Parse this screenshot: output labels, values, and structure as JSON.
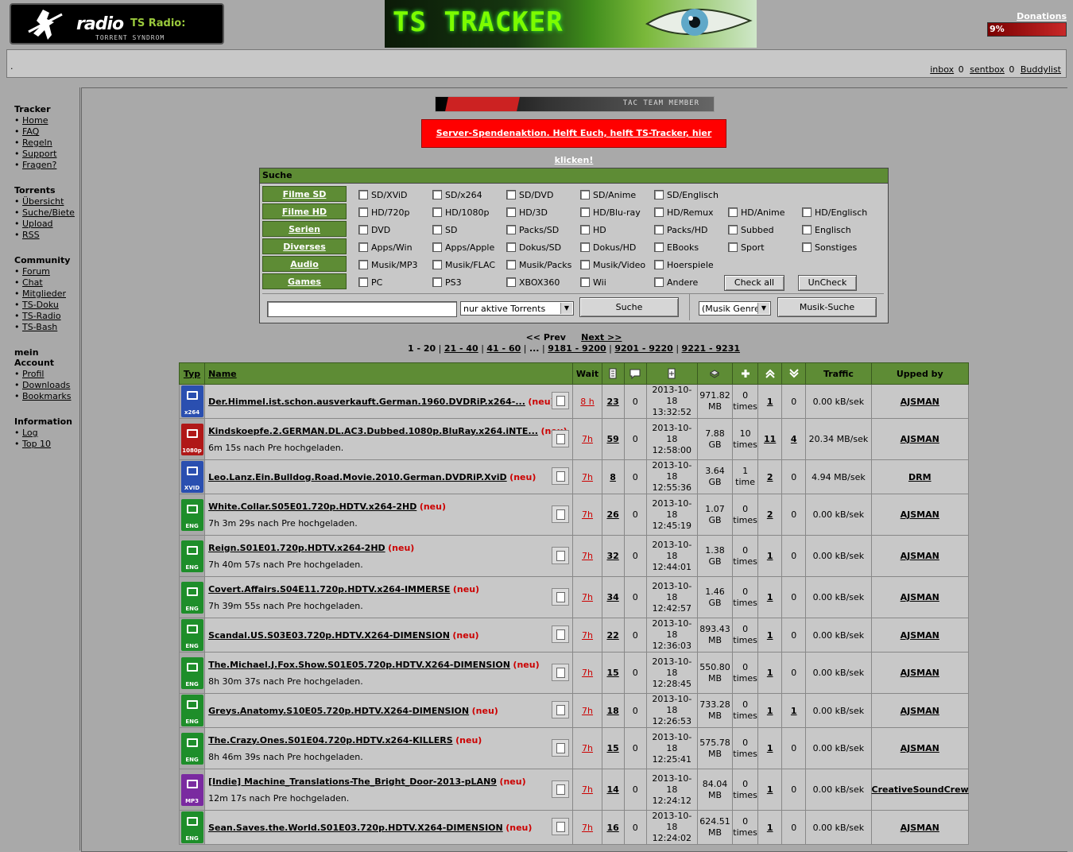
{
  "logo": {
    "text": "radio",
    "sub": "TS Radio:",
    "tagline": "TORRENT SYNDROM"
  },
  "banner": {
    "title": "TS TRACKER"
  },
  "donations": {
    "label": "Donations",
    "percent": "9%",
    "fraction": 0.09
  },
  "userlinks": {
    "inbox_label": "inbox",
    "inbox_count": "0",
    "sentbox_label": "sentbox",
    "sentbox_count": "0",
    "buddylist_label": "Buddylist"
  },
  "sidebar": [
    {
      "title": "Tracker",
      "items": [
        "Home",
        "FAQ",
        "Regeln",
        "Support",
        "Fragen?"
      ]
    },
    {
      "title": "Torrents",
      "items": [
        "Übersicht",
        "Suche/Biete",
        "Upload",
        "RSS"
      ]
    },
    {
      "title": "Community",
      "items": [
        "Forum",
        "Chat",
        "Mitglieder",
        "TS-Doku",
        "TS-Radio",
        "TS-Bash"
      ]
    },
    {
      "title": "mein Account",
      "items": [
        "Profil",
        "Downloads",
        "Bookmarks"
      ]
    },
    {
      "title": "Information",
      "items": [
        "Log",
        "Top 10"
      ]
    }
  ],
  "tac": {
    "text": "TAC TEAM MEMBER"
  },
  "spende": {
    "text": "Server-Spendenaktion. Helft Euch, helft TS-Tracker, hier klicken!"
  },
  "search": {
    "header": "Suche",
    "categories": [
      "Filme SD",
      "Filme HD",
      "Serien",
      "Diverses",
      "Audio",
      "Games"
    ],
    "checkbox_rows": [
      [
        "SD/XViD",
        "SD/x264",
        "SD/DVD",
        "SD/Anime",
        "SD/Englisch"
      ],
      [
        "HD/720p",
        "HD/1080p",
        "HD/3D",
        "HD/Blu-ray",
        "HD/Remux",
        "HD/Anime",
        "HD/Englisch"
      ],
      [
        "DVD",
        "SD",
        "Packs/SD",
        "HD",
        "Packs/HD",
        "Subbed",
        "Englisch"
      ],
      [
        "Apps/Win",
        "Apps/Apple",
        "Dokus/SD",
        "Dokus/HD",
        "EBooks",
        "Sport",
        "Sonstiges"
      ],
      [
        "Musik/MP3",
        "Musik/FLAC",
        "Musik/Packs",
        "Musik/Video",
        "Hoerspiele"
      ],
      [
        "PC",
        "PS3",
        "XBOX360",
        "Wii",
        "Andere"
      ]
    ],
    "check_all": "Check all",
    "uncheck": "UnCheck",
    "query": "",
    "filter_selected": "nur aktive Torrents",
    "submit": "Suche",
    "genre_selected": "(Musik Genre)",
    "music_submit": "Musik-Suche"
  },
  "pager": {
    "prev": "<< Prev",
    "next": "Next >>",
    "pages": [
      "1 - 20",
      "21 - 40",
      "41 - 60",
      "...",
      "9181 - 9200",
      "9201 - 9220",
      "9221 - 9231"
    ]
  },
  "table": {
    "headers": {
      "typ": "Typ",
      "name": "Name",
      "wait": "Wait",
      "traffic": "Traffic",
      "upped": "Upped by"
    },
    "rows": [
      {
        "icon": "x264",
        "color": "#2a4fb0",
        "name": "Der.Himmel.ist.schon.ausverkauft.German.1960.DVDRiP.x264-...",
        "neu": "(neu)",
        "pre": "",
        "wait": "8 h",
        "files": "23",
        "comments": "0",
        "date": "2013-10-18",
        "time": "13:32:52",
        "size": "971.82",
        "unit": "MB",
        "snatched": "0",
        "times": "times",
        "seeders": "1",
        "leechers": "0",
        "traffic": "0.00 kB/sek",
        "upper": "AJSMAN"
      },
      {
        "icon": "1080p",
        "color": "#b01818",
        "name": "Kindskoepfe.2.GERMAN.DL.AC3.Dubbed.1080p.BluRay.x264.iNTE...",
        "neu": "(neu)",
        "pre": "6m 15s nach Pre hochgeladen.",
        "wait": "7h",
        "files": "59",
        "comments": "0",
        "date": "2013-10-18",
        "time": "12:58:00",
        "size": "7.88",
        "unit": "GB",
        "snatched": "10",
        "times": "times",
        "seeders": "11",
        "leechers": "4",
        "traffic": "20.34 MB/sek",
        "upper": "AJSMAN"
      },
      {
        "icon": "XVID",
        "color": "#2a4fb0",
        "name": "Leo.Lanz.Ein.Bulldog.Road.Movie.2010.German.DVDRiP.XviD",
        "neu": "(neu)",
        "pre": "",
        "wait": "7h",
        "files": "8",
        "comments": "0",
        "date": "2013-10-18",
        "time": "12:55:36",
        "size": "3.64",
        "unit": "GB",
        "snatched": "1",
        "times": "time",
        "seeders": "2",
        "leechers": "0",
        "traffic": "4.94 MB/sek",
        "upper": "DRM"
      },
      {
        "icon": "ENG",
        "color": "#1e8e2a",
        "name": "White.Collar.S05E01.720p.HDTV.x264-2HD",
        "neu": "(neu)",
        "pre": "7h 3m 29s nach Pre hochgeladen.",
        "wait": "7h",
        "files": "26",
        "comments": "0",
        "date": "2013-10-18",
        "time": "12:45:19",
        "size": "1.07",
        "unit": "GB",
        "snatched": "0",
        "times": "times",
        "seeders": "2",
        "leechers": "0",
        "traffic": "0.00 kB/sek",
        "upper": "AJSMAN"
      },
      {
        "icon": "ENG",
        "color": "#1e8e2a",
        "name": "Reign.S01E01.720p.HDTV.x264-2HD",
        "neu": "(neu)",
        "pre": "7h 40m 57s nach Pre hochgeladen.",
        "wait": "7h",
        "files": "32",
        "comments": "0",
        "date": "2013-10-18",
        "time": "12:44:01",
        "size": "1.38",
        "unit": "GB",
        "snatched": "0",
        "times": "times",
        "seeders": "1",
        "leechers": "0",
        "traffic": "0.00 kB/sek",
        "upper": "AJSMAN"
      },
      {
        "icon": "ENG",
        "color": "#1e8e2a",
        "name": "Covert.Affairs.S04E11.720p.HDTV.x264-IMMERSE",
        "neu": "(neu)",
        "pre": "7h 39m 55s nach Pre hochgeladen.",
        "wait": "7h",
        "files": "34",
        "comments": "0",
        "date": "2013-10-18",
        "time": "12:42:57",
        "size": "1.46",
        "unit": "GB",
        "snatched": "0",
        "times": "times",
        "seeders": "1",
        "leechers": "0",
        "traffic": "0.00 kB/sek",
        "upper": "AJSMAN"
      },
      {
        "icon": "ENG",
        "color": "#1e8e2a",
        "name": "Scandal.US.S03E03.720p.HDTV.X264-DIMENSION",
        "neu": "(neu)",
        "pre": "",
        "wait": "7h",
        "files": "22",
        "comments": "0",
        "date": "2013-10-18",
        "time": "12:36:03",
        "size": "893.43",
        "unit": "MB",
        "snatched": "0",
        "times": "times",
        "seeders": "1",
        "leechers": "0",
        "traffic": "0.00 kB/sek",
        "upper": "AJSMAN"
      },
      {
        "icon": "ENG",
        "color": "#1e8e2a",
        "name": "The.Michael.J.Fox.Show.S01E05.720p.HDTV.X264-DIMENSION",
        "neu": "(neu)",
        "pre": "8h 30m 37s nach Pre hochgeladen.",
        "wait": "7h",
        "files": "15",
        "comments": "0",
        "date": "2013-10-18",
        "time": "12:28:45",
        "size": "550.80",
        "unit": "MB",
        "snatched": "0",
        "times": "times",
        "seeders": "1",
        "leechers": "0",
        "traffic": "0.00 kB/sek",
        "upper": "AJSMAN"
      },
      {
        "icon": "ENG",
        "color": "#1e8e2a",
        "name": "Greys.Anatomy.S10E05.720p.HDTV.X264-DIMENSION",
        "neu": "(neu)",
        "pre": "",
        "wait": "7h",
        "files": "18",
        "comments": "0",
        "date": "2013-10-18",
        "time": "12:26:53",
        "size": "733.28",
        "unit": "MB",
        "snatched": "0",
        "times": "times",
        "seeders": "1",
        "leechers": "1",
        "traffic": "0.00 kB/sek",
        "upper": "AJSMAN"
      },
      {
        "icon": "ENG",
        "color": "#1e8e2a",
        "name": "The.Crazy.Ones.S01E04.720p.HDTV.x264-KILLERS",
        "neu": "(neu)",
        "pre": "8h 46m 39s nach Pre hochgeladen.",
        "wait": "7h",
        "files": "15",
        "comments": "0",
        "date": "2013-10-18",
        "time": "12:25:41",
        "size": "575.78",
        "unit": "MB",
        "snatched": "0",
        "times": "times",
        "seeders": "1",
        "leechers": "0",
        "traffic": "0.00 kB/sek",
        "upper": "AJSMAN"
      },
      {
        "icon": "MP3",
        "color": "#7a2aa0",
        "name": "[Indie] Machine_Translations-The_Bright_Door-2013-pLAN9",
        "neu": "(neu)",
        "pre": "12m 17s nach Pre hochgeladen.",
        "wait": "7h",
        "files": "14",
        "comments": "0",
        "date": "2013-10-18",
        "time": "12:24:12",
        "size": "84.04",
        "unit": "MB",
        "snatched": "0",
        "times": "times",
        "seeders": "1",
        "leechers": "0",
        "traffic": "0.00 kB/sek",
        "upper": "CreativeSoundCrew"
      },
      {
        "icon": "ENG",
        "color": "#1e8e2a",
        "name": "Sean.Saves.the.World.S01E03.720p.HDTV.X264-DIMENSION",
        "neu": "(neu)",
        "pre": "",
        "wait": "7h",
        "files": "16",
        "comments": "0",
        "date": "2013-10-18",
        "time": "12:24:02",
        "size": "624.51",
        "unit": "MB",
        "snatched": "0",
        "times": "times",
        "seeders": "1",
        "leechers": "0",
        "traffic": "0.00 kB/sek",
        "upper": "AJSMAN"
      }
    ]
  }
}
